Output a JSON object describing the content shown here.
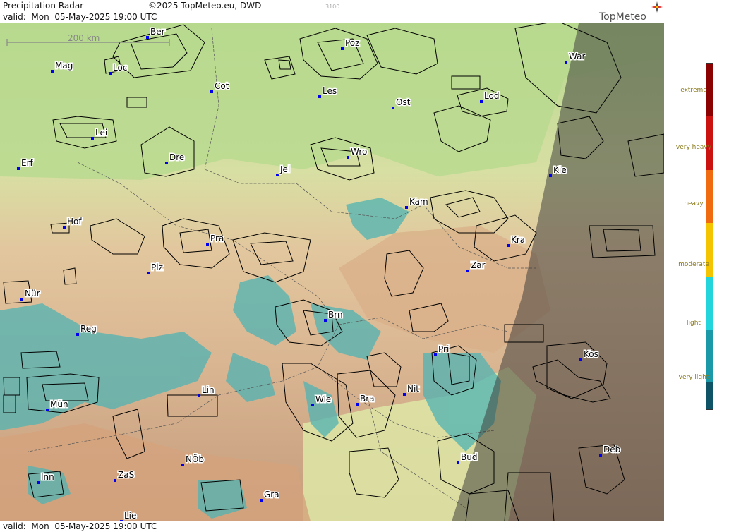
{
  "header": {
    "title": "Precipitation Radar",
    "copyright": "©2025 TopMeteo.eu, DWD",
    "code": "3100",
    "valid": "valid:  Mon  05-May-2025 19:00 UTC",
    "brand": "TopMeteo"
  },
  "footer": {
    "valid": "valid:  Mon  05-May-2025 19:00 UTC"
  },
  "map": {
    "scale_label": "200 km",
    "cities": [
      {
        "name": "Ber"
      },
      {
        "name": "Poz"
      },
      {
        "name": "War"
      },
      {
        "name": "Mag"
      },
      {
        "name": "Loc"
      },
      {
        "name": "Cot"
      },
      {
        "name": "Les"
      },
      {
        "name": "Ost"
      },
      {
        "name": "Lod"
      },
      {
        "name": "Lei"
      },
      {
        "name": "Erf"
      },
      {
        "name": "Dre"
      },
      {
        "name": "Wro"
      },
      {
        "name": "Jel"
      },
      {
        "name": "Kie"
      },
      {
        "name": "Kam"
      },
      {
        "name": "Hof"
      },
      {
        "name": "Pra"
      },
      {
        "name": "Kra"
      },
      {
        "name": "Plz"
      },
      {
        "name": "Zar"
      },
      {
        "name": "Nür"
      },
      {
        "name": "Brn"
      },
      {
        "name": "Reg"
      },
      {
        "name": "Pri"
      },
      {
        "name": "Kos"
      },
      {
        "name": "Nit"
      },
      {
        "name": "Lin"
      },
      {
        "name": "Mün"
      },
      {
        "name": "Wie"
      },
      {
        "name": "Bra"
      },
      {
        "name": "Deb"
      },
      {
        "name": "Bud"
      },
      {
        "name": "NÖb"
      },
      {
        "name": "Inn"
      },
      {
        "name": "ZaS"
      },
      {
        "name": "Gra"
      },
      {
        "name": "Lie"
      }
    ]
  },
  "legend": {
    "colors": [
      "#8b0000",
      "#cc1111",
      "#f06a10",
      "#f5c400",
      "#22d4dc",
      "#1a9aa8",
      "#0e5466"
    ],
    "labels": [
      "extreme",
      "very heavy",
      "heavy",
      "moderate",
      "light",
      "very light"
    ]
  }
}
